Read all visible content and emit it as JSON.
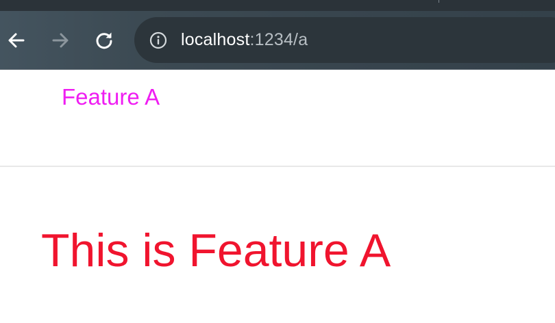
{
  "browser": {
    "address_bar": {
      "host": "localhost",
      "path": ":1234/a"
    },
    "icons": {
      "back": "arrow-left-icon",
      "forward": "arrow-right-icon",
      "reload": "reload-icon",
      "site_info": "info-icon"
    },
    "colors": {
      "toolbar": "#3c4a53",
      "omnibox": "#2c353b",
      "host_text": "#ffffff",
      "path_text": "#b7bec3"
    }
  },
  "page": {
    "nav_link": "Feature A",
    "heading": "This is Feature A",
    "colors": {
      "nav_link": "#ef1ef2",
      "heading": "#f0142e"
    }
  }
}
